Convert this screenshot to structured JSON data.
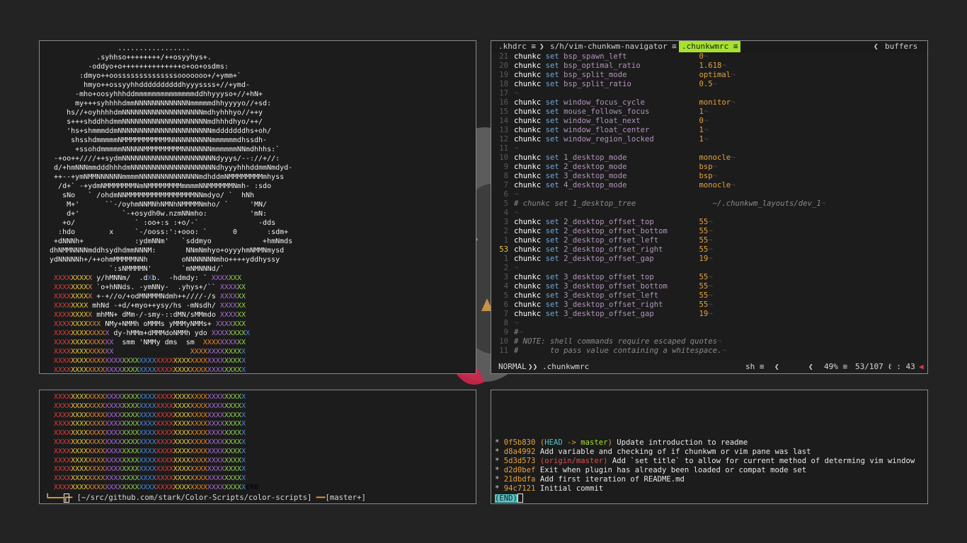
{
  "colors": {
    "desktop": "#232323",
    "accent_green": "#a6e22e",
    "red": "#e03a3a"
  },
  "art": {
    "lines": [
      "                 .................",
      "            .syhhso++++++++/++osyyhys+.",
      "          -oddyo+o++++++++++++++o+oo+osdms:",
      "        :dmyo++oossssssssssssssooooooo+/+ymm+`",
      "         hmyo++ossyyhhddddddddddhyyyssss+//+ymd-",
      "       -mho+oosyhhhddmmmmmmmmmmmmmmddhhyyyso+//+hN+",
      "       my+++syhhhhdmmNNNNNNNNNNNNNmmmmmdhhyyyyo//+sd:",
      "     hs//+oyhhhhdmNNNNNNNNNNNNNNNNNNNmdhyhhhyo//++y",
      "     s+++shddhhdmmNNNNNNNNNNNNNNNNNNNNmdhhhdhyo/++/",
      "     'hs+shmmmddmNNNNNNNNNNNNNNNNNNNNNNmdddddddhs+oh/",
      "      shsshdmmmmmNMMMMMMMMMMMNNNNNNNNNNmmmmmmdhssdh-",
      "       +ssohdmmmmmNNNNNMMMMMMMMMNNNNNNNmmmmmmNNmdhhhs:`",
      "  -+oo++////++sydmNNNNNNNNNNNNNNNNNNNNNNdyyys/--://+//:",
      "  d/+hmNNNmmdddhhhdmNNNNNNNNNNNNNNNNNNNNdhyyyhhhddmmNmdyd-",
      "  ++--+ymNMMNNNNNNmmmmNNNNNNNNNNNNNNmdhddmNMMMMMMMMmhyss",
      "   /d+` -+ydmNMMMMMMMNmNMMMMMMMMmmmmNNMMMMMMNmh- :sdo",
      "    sNo   ` /ohdmNNMMMMMMMMMMMMMMMMNNmdyo/ `  hNh",
      "     M+'      ``-/oyhmNNMNhNMNhNMMMMNmho/ `     'MN/",
      "     d+'          `-+osydh0w.nzmNNmho:          'mN:",
      "    +o/              ` :oo+:s :+o/-`              -dds",
      "   :hdo        x     `-/ooss:':+ooo: `      0       :sdm+",
      "  +dNNNh+            :ydmNNm'   `sddmyo            +hmNmds",
      " dhNMMNNNNmddhsydhdmmNNNM:       NNmNmhyo+oyyyhmNMMNmysd",
      " ydNNNNNh+/++ohmMMMMMNNh        oNNNNNNNmho++++yddhyssy",
      "               `:sNMMMMN'       `mNMNNNd/`",
      "  XXXXXXXXX y/hMNNm/  .dXb.  -hdmdy: ` XXXXXXX",
      "  XXXXXXXXX `o+hNNds. -ymNNy-  .yhys+/`` XXXXXX",
      "  XXXXXXXXX +-+//o/+odMNMMMNdmh++////-/s XXXXXX",
      "  XXXXXXXX mhNd -+d/+myo++ysy/hs -mNsdh/ XXXXXX",
      "  XXXXXXXXX mhMN+ dMm-/-smy-::dMN/sMMmdo XXXXXX",
      "  XXXXXXXXXXX NMy+NMMh oMMMs yMMMyNMMs+ XXXXXXX",
      "  XXXXXXXXXXXXX dy-hMMm+dMMMdoNMMh ydo XXXXXXXXX",
      "  XXXXXXXXXXXXXX  smm 'NMMy dms  sm  XXXXXXXXXX",
      "  XXXXXXXXXXXXXX                  XXXXXXXXXXXXX",
      "  XXXXXXXXXXXXXXXXXXXXXXXXXXXXXXXXXXXXXXXXXXXXX",
      "  XXXXXXXXXXXXXXXXXXXXXXXXXXXXXXXXXXXXXXXXXXXXX"
    ],
    "bars": [
      "  XXXXXXXXXXXXXXXXXXXXXXXXXXXXXXXXXXXXXXXXXXXXX",
      "  XXXXXXXXXXXXXXXXXXXXXXXXXXXXXXXXXXXXXXXXXXXXX",
      "  XXXXXXXXXXXXXXXXXXXXXXXXXXXXXXXXXXXXXXXXXXXXX",
      "  XXXXXXXXXXXXXXXXXXXXXXXXXXXXXXXXXXXXXXXXXXXXX",
      "  XXXXXXXXXXXXXXXXXXXXXXXXXXXXXXXXXXXXXXXXXXXXX",
      "  XXXXXXXXXXXXXXXXXXXXXXXXXXXXXXXXXXXXXXXXXXXXX",
      "  XXXXXXXXXXXXXXXXXXXXXXXXXXXXXXXXXXXXXXXXXXXXX",
      "  XXXXXXXXXXXXXXXXXXXXXXXXXXXXXXXXXXXXXXXXXXXXX",
      "  XXXXXXXXXXXXXXXXXXXXXXXXXXXXXXXXXXXXXXXXXXXXX",
      "  XXXXXXXXXXXXXXXXXXXXXXXXXXXXXXXXXXXXXXXXXXXXX",
      "  XXXXXXXXXXXXXXXXXXXXXXXXXXXXXXXXXXXXXXXXXXXXXER0"
    ],
    "bar_colors": [
      "#e03a3a",
      "#e8c840",
      "#e8872c",
      "#a86cd0",
      "#8fd14f",
      "#4a86d6",
      "#e8e8e8"
    ]
  },
  "shell": {
    "path": "[~/src/github.com/stark/Color-Scripts/color-scripts]",
    "branch": "[master+]"
  },
  "vim": {
    "tabs": {
      "tab1": ".khdrc ≡",
      "tab2": "s/h/vim-chunkwm-navigator ≡",
      "tab3": ".chunkwmrc ≡",
      "buffers": "buffers"
    },
    "lines": [
      {
        "n": "21",
        "kw": "chunkc",
        "set": "set",
        "opt": "bsp_spawn_left",
        "val": "0"
      },
      {
        "n": "20",
        "kw": "chunkc",
        "set": "set",
        "opt": "bsp_optimal_ratio",
        "val": "1.618"
      },
      {
        "n": "19",
        "kw": "chunkc",
        "set": "set",
        "opt": "bsp_split_mode",
        "val": "optimal"
      },
      {
        "n": "18",
        "kw": "chunkc",
        "set": "set",
        "opt": "bsp_split_ratio",
        "val": "0.5"
      },
      {
        "n": "17",
        "kw": "",
        "set": "",
        "opt": "",
        "val": ""
      },
      {
        "n": "16",
        "kw": "chunkc",
        "set": "set",
        "opt": "window_focus_cycle",
        "val": "monitor"
      },
      {
        "n": "15",
        "kw": "chunkc",
        "set": "set",
        "opt": "mouse_follows_focus",
        "val": "1"
      },
      {
        "n": "14",
        "kw": "chunkc",
        "set": "set",
        "opt": "window_float_next",
        "val": "0"
      },
      {
        "n": "13",
        "kw": "chunkc",
        "set": "set",
        "opt": "window_float_center",
        "val": "1"
      },
      {
        "n": "12",
        "kw": "chunkc",
        "set": "set",
        "opt": "window_region_locked",
        "val": "1"
      },
      {
        "n": "11",
        "kw": "",
        "set": "",
        "opt": "",
        "val": ""
      },
      {
        "n": "10",
        "kw": "chunkc",
        "set": "set",
        "opt": "1_desktop_mode",
        "val": "monocle"
      },
      {
        "n": "9",
        "kw": "chunkc",
        "set": "set",
        "opt": "2_desktop_mode",
        "val": "bsp"
      },
      {
        "n": "8",
        "kw": "chunkc",
        "set": "set",
        "opt": "3_desktop_mode",
        "val": "bsp"
      },
      {
        "n": "7",
        "kw": "chunkc",
        "set": "set",
        "opt": "4_desktop_mode",
        "val": "monocle"
      },
      {
        "n": "6",
        "kw": "",
        "set": "",
        "opt": "",
        "val": ""
      },
      {
        "n": "5",
        "comment": "# chunkc set 1_desktop_tree                 ~/.chunkwm_layouts/dev_1"
      },
      {
        "n": "4",
        "kw": "",
        "set": "",
        "opt": "",
        "val": ""
      },
      {
        "n": "3",
        "kw": "chunkc",
        "set": "set",
        "opt": "2_desktop_offset_top",
        "val": "55"
      },
      {
        "n": "2",
        "kw": "chunkc",
        "set": "set",
        "opt": "2_desktop_offset_bottom",
        "val": "55"
      },
      {
        "n": "1",
        "kw": "chunkc",
        "set": "set",
        "opt": "2_desktop_offset_left",
        "val": "55"
      },
      {
        "n": "53",
        "kw": "chunkc",
        "set": "set",
        "opt": "2_desktop_offset_right",
        "val": "55",
        "current": true
      },
      {
        "n": "1",
        "kw": "chunkc",
        "set": "set",
        "opt": "2_desktop_offset_gap",
        "val": "19"
      },
      {
        "n": "2",
        "kw": "",
        "set": "",
        "opt": "",
        "val": ""
      },
      {
        "n": "3",
        "kw": "chunkc",
        "set": "set",
        "opt": "3_desktop_offset_top",
        "val": "55"
      },
      {
        "n": "4",
        "kw": "chunkc",
        "set": "set",
        "opt": "3_desktop_offset_bottom",
        "val": "55"
      },
      {
        "n": "5",
        "kw": "chunkc",
        "set": "set",
        "opt": "3_desktop_offset_left",
        "val": "55"
      },
      {
        "n": "6",
        "kw": "chunkc",
        "set": "set",
        "opt": "3_desktop_offset_right",
        "val": "55"
      },
      {
        "n": "7",
        "kw": "chunkc",
        "set": "set",
        "opt": "3_desktop_offset_gap",
        "val": "19"
      },
      {
        "n": "8",
        "kw": "",
        "set": "",
        "opt": "",
        "val": ""
      },
      {
        "n": "9",
        "comment": "#"
      },
      {
        "n": "10",
        "comment": "# NOTE: shell commands require escaped quotes"
      },
      {
        "n": "11",
        "comment": "#       to pass value containing a whitespace."
      }
    ],
    "status": {
      "mode": "NORMAL",
      "file": ".chunkwmrc",
      "ft": "sh ≡",
      "pct": "49% ≡",
      "pos": "53/107 ℓ : 43"
    }
  },
  "git": {
    "commits": [
      {
        "hash": "0f5b830",
        "refs": true,
        "msg": "Update introduction to readme"
      },
      {
        "hash": "d8a4992",
        "msg": "Add variable and checking of if chunkwm or vim pane was last"
      },
      {
        "hash": "5d3d573",
        "origin": "(origin/master)",
        "msg": "Add `set title` to allow for current method of determing vim window"
      },
      {
        "hash": "d2d0bef",
        "msg": "Exit when plugin has already been loaded or compat mode set"
      },
      {
        "hash": "21dbdfa",
        "msg": "Add first iteration of README.md"
      },
      {
        "hash": "94c7121",
        "msg": "Initial commit"
      }
    ],
    "head_label": "HEAD",
    "arrow": " -> ",
    "master_label": "master",
    "end_label": "(END)"
  }
}
